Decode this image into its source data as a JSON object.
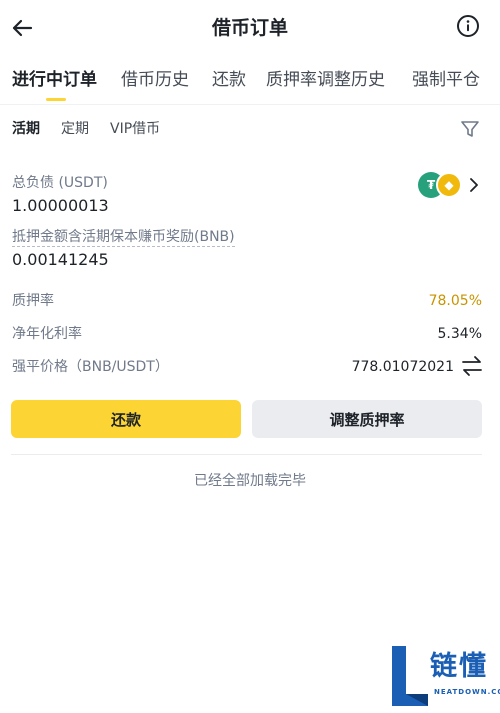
{
  "header": {
    "title": "借币订单"
  },
  "tabs": [
    {
      "label": "进行中订单"
    },
    {
      "label": "借币历史"
    },
    {
      "label": "还款"
    },
    {
      "label": "质押率调整历史"
    },
    {
      "label": "强制平仓"
    }
  ],
  "subtabs": [
    {
      "label": "活期"
    },
    {
      "label": "定期"
    },
    {
      "label": "VIP借币"
    }
  ],
  "order": {
    "debt_label": "总负债 (USDT)",
    "debt_value": "1.00000013",
    "collateral_label": "抵押金额含活期保本赚币奖励(BNB)",
    "collateral_value": "0.00141245",
    "coins": [
      {
        "symbol": "₮",
        "color": "#26a17b"
      },
      {
        "symbol": "◆",
        "color": "#f0b90b"
      }
    ],
    "ltv_label": "质押率",
    "ltv_value": "78.05%",
    "rate_label": "净年化利率",
    "rate_value": "5.34%",
    "liq_label": "强平价格（BNB/USDT）",
    "liq_value": "778.01072021"
  },
  "actions": {
    "repay_label": "还款",
    "adjust_label": "调整质押率"
  },
  "footer": {
    "end_text": "已经全部加载完毕"
  },
  "watermark": {
    "text": "链懂",
    "sub": "NEATDOWN.COM"
  },
  "colors": {
    "accent": "#fcd535",
    "ltv": "#c99400",
    "watermark": "#1a5fb4"
  }
}
